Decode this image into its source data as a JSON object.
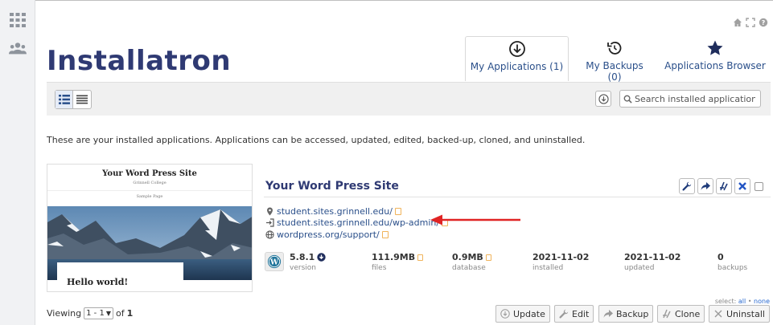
{
  "brand": {
    "logo_text": "Installatron"
  },
  "nav": {
    "tabs": [
      {
        "label": "My Applications (1)",
        "icon": "download-circle-icon",
        "active": true
      },
      {
        "label": "My Backups (0)",
        "icon": "history-icon",
        "active": false
      },
      {
        "label": "Applications Browser",
        "icon": "star-icon",
        "active": false
      }
    ]
  },
  "toolbar": {
    "search_placeholder": "Search installed applications"
  },
  "intro_text": "These are your installed applications. Applications can be accessed, updated, edited, backed-up, cloned, and uninstalled.",
  "app": {
    "title": "Your Word Press Site",
    "preview": {
      "site_title": "Your Word Press Site",
      "tagline": "Grinnell College",
      "menu": "Sample Page",
      "post_title": "Hello world!"
    },
    "links": [
      {
        "text": "student.sites.grinnell.edu/",
        "icon": "map-pin-icon"
      },
      {
        "text": "student.sites.grinnell.edu/wp-admin/",
        "icon": "login-icon"
      },
      {
        "text": "wordpress.org/support/",
        "icon": "globe-icon"
      }
    ],
    "stats": {
      "version": {
        "value": "5.8.1",
        "label": "version"
      },
      "files": {
        "value": "111.9MB",
        "label": "files"
      },
      "database": {
        "value": "0.9MB",
        "label": "database"
      },
      "installed": {
        "value": "2021-11-02",
        "label": "installed"
      },
      "updated": {
        "value": "2021-11-02",
        "label": "updated"
      },
      "backups": {
        "value": "0",
        "label": "backups"
      }
    }
  },
  "selection": {
    "prefix": "select:",
    "all": "all",
    "separator": "•",
    "none": "none"
  },
  "pagination": {
    "prefix": "Viewing",
    "range": "1 - 1",
    "of": "of",
    "total": "1"
  },
  "bottom_actions": {
    "update": "Update",
    "edit": "Edit",
    "backup": "Backup",
    "clone": "Clone",
    "uninstall": "Uninstall"
  },
  "colors": {
    "brand": "#2f3a73",
    "link": "#2a4f8a",
    "annotation_arrow": "#e02424",
    "danger": "#2255c4"
  }
}
